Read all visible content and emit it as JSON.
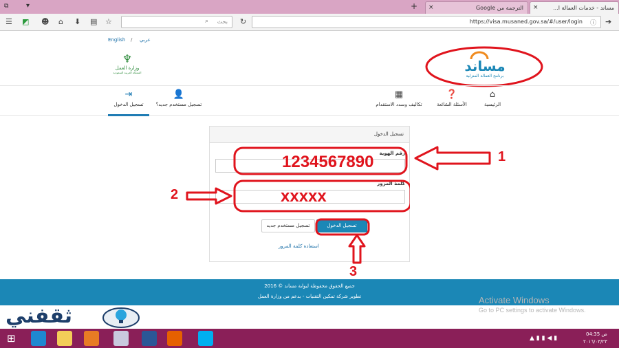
{
  "browser": {
    "tabs": [
      {
        "label": "مساند - خدمات العمالة ا..."
      },
      {
        "label": "الترجمة من Google"
      }
    ],
    "url": "https://visa.musaned.gov.sa/#/user/login",
    "search_placeholder": "بحث"
  },
  "header": {
    "lang_arabic": "عربي",
    "lang_sep": "/",
    "lang_english": "English",
    "logo_text": "مساند",
    "logo_sub": "برنامج العمالة المنزلية",
    "ministry": "وزارة العمل",
    "ministry_sub": "المملكة العربية السعودية"
  },
  "menu": {
    "home": "الرئيسية",
    "faq": "الأسئلة الشائعة",
    "costs": "تكاليف وسدد الاستقدام",
    "register": "تسجيل مستخدم جديد؟",
    "login": "تسجيل الدخول"
  },
  "login": {
    "title": "تسجيل الدخول",
    "id_label": "رقم الهوية",
    "id_value": "1234567890",
    "password_label": "كلمة المرور",
    "password_value": "xxxxx",
    "login_button": "تسجيل الدخول",
    "register_button": "تسجيل مستخدم جديد",
    "forgot_link": "استعادة كلمة المرور"
  },
  "footer": {
    "line1": "جميع الحقوق محفوظة لبوابة مساند © 2016",
    "line2": "تطوير شركة تمكين التقنيات - بدعم من وزارة العمل"
  },
  "annotations": {
    "n1": "1",
    "n2": "2",
    "n3": "3",
    "color": "#e0141d"
  },
  "watermark": {
    "line1": "Activate Windows",
    "line2": "Go to PC settings to activate Windows."
  },
  "brand_logo": "ثقفني",
  "taskbar": {
    "time": "04:35 ص",
    "date": "٢٠١٦/٠٣/٢٣"
  }
}
